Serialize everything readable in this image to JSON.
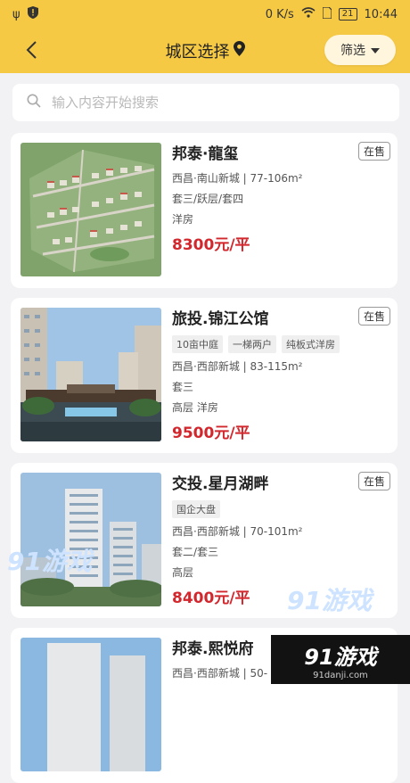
{
  "status_bar": {
    "network_speed": "0 K/s",
    "battery": "21",
    "time": "10:44"
  },
  "nav": {
    "title": "城区选择",
    "filter_label": "筛选"
  },
  "search": {
    "placeholder": "输入内容开始搜索"
  },
  "listings": [
    {
      "name": "邦泰·龍玺",
      "status": "在售",
      "tags": [],
      "location": "西昌·南山新城 | 77-106m²",
      "layout": "套三/跃层/套四",
      "type": "洋房",
      "price": "8300元/平"
    },
    {
      "name": "旅投.锦江公馆",
      "status": "在售",
      "tags": [
        "10亩中庭",
        "一梯两户",
        "纯板式洋房"
      ],
      "location": "西昌·西部新城 | 83-115m²",
      "layout": "套三",
      "type": "高层 洋房",
      "price": "9500元/平"
    },
    {
      "name": "交投.星月湖畔",
      "status": "在售",
      "tags": [
        "国企大盘"
      ],
      "location": "西昌·西部新城 | 70-101m²",
      "layout": "套二/套三",
      "type": "高层",
      "price": "8400元/平"
    },
    {
      "name": "邦泰.熙悦府",
      "status": "",
      "tags": [],
      "location": "西昌·西部新城 | 50-",
      "layout": "",
      "type": "",
      "price": ""
    }
  ],
  "watermark": {
    "text": "91游戏",
    "sub": "91danji.com"
  },
  "colors": {
    "header": "#f6c945",
    "price": "#d1272d"
  }
}
